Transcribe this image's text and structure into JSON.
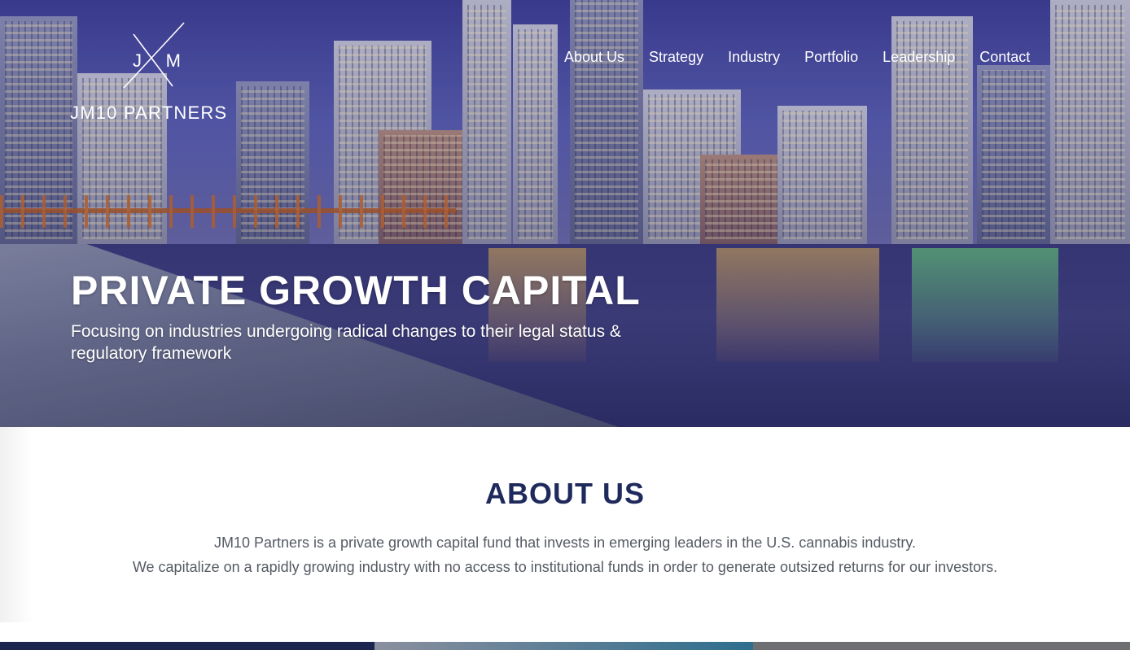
{
  "brand": {
    "monogram_left": "J",
    "monogram_right": "M",
    "name": "JM10 PARTNERS"
  },
  "nav": {
    "items": [
      "About Us",
      "Strategy",
      "Industry",
      "Portfolio",
      "Leadership",
      "Contact"
    ]
  },
  "hero": {
    "title": "PRIVATE GROWTH CAPITAL",
    "subtitle": "Focusing on industries undergoing radical changes to their legal status & regulatory framework"
  },
  "about": {
    "title": "ABOUT US",
    "line1": "JM10 Partners is a private growth capital fund that invests in emerging leaders in the U.S. cannabis industry.",
    "line2": "We capitalize on a rapidly growing industry with no access to institutional funds in order to generate outsized returns for our investors."
  },
  "colors": {
    "accent": "#1f2a5c",
    "body_text": "#555a63"
  }
}
